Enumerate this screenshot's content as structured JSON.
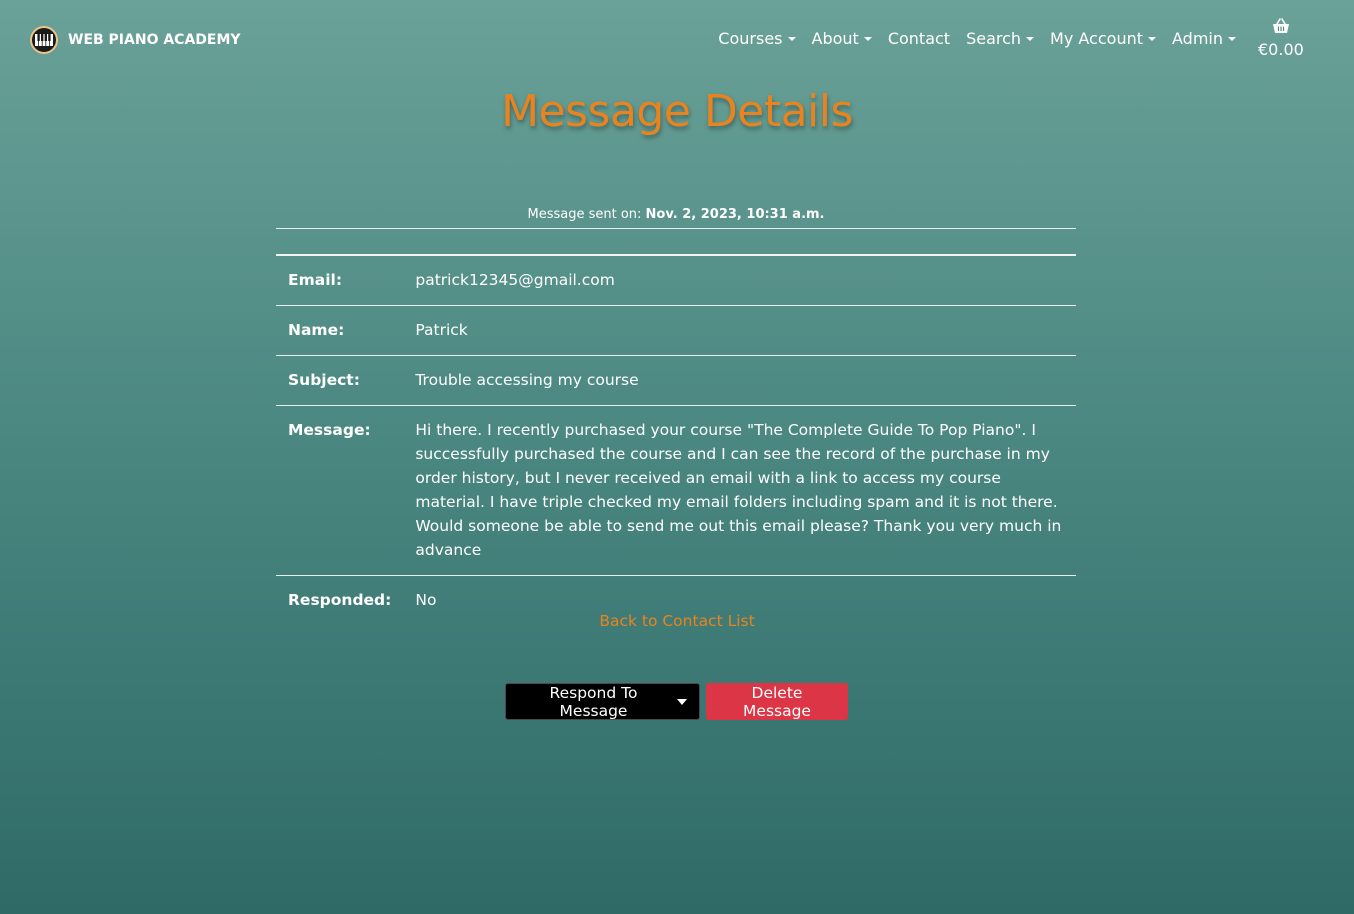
{
  "brand": {
    "name": "WEB PIANO ACADEMY",
    "logo_icon": "piano-keys-icon"
  },
  "nav": {
    "items": [
      {
        "label": "Courses",
        "dropdown": true
      },
      {
        "label": "About",
        "dropdown": true
      },
      {
        "label": "Contact",
        "dropdown": false
      },
      {
        "label": "Search",
        "dropdown": true
      },
      {
        "label": "My Account",
        "dropdown": true
      },
      {
        "label": "Admin",
        "dropdown": true
      }
    ],
    "cart": {
      "icon": "basket-icon",
      "total": "€0.00"
    }
  },
  "page": {
    "title": "Message Details"
  },
  "message": {
    "sent_label": "Message sent on:",
    "sent_date": "Nov. 2, 2023, 10:31 a.m.",
    "rows": [
      {
        "label": "Email:",
        "value": "patrick12345@gmail.com"
      },
      {
        "label": "Name:",
        "value": "Patrick"
      },
      {
        "label": "Subject:",
        "value": "Trouble accessing my course"
      },
      {
        "label": "Message:",
        "value": "Hi there. I recently purchased your course \"The Complete Guide To Pop Piano\". I successfully purchased the course and I can see the record of the purchase in my order history, but I never received an email with a link to access my course material. I have triple checked my email folders including spam and it is not there. Would someone be able to send me out this email please? Thank you very much in advance"
      },
      {
        "label": "Responded:",
        "value": "No"
      }
    ]
  },
  "links": {
    "back": "Back to Contact List"
  },
  "actions": {
    "respond": "Respond To Message",
    "delete": "Delete Message"
  },
  "colors": {
    "accent": "#e8841f",
    "danger": "#dc3545",
    "dark_button": "#000000"
  }
}
